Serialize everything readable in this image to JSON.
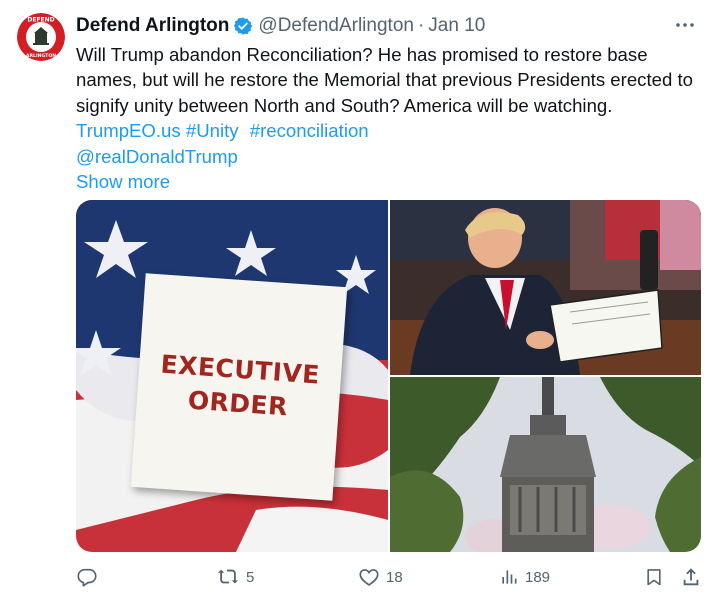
{
  "account": {
    "display_name": "Defend Arlington",
    "handle": "@DefendArlington",
    "separator": "·",
    "date": "Jan 10",
    "avatar_text_top": "DEFEND",
    "avatar_text_bottom": "ARLINGTON"
  },
  "tweet": {
    "text": "Will Trump abandon Reconciliation?  He has promised to restore base names, but will he restore the Memorial that previous Presidents erected to signify unity between North and South? America will be watching.",
    "link1": "TrumpEO.us",
    "hashtags": [
      "#Unity",
      "#reconciliation"
    ],
    "mention": "@realDonaldTrump",
    "show_more": "Show more"
  },
  "media": {
    "card_line1": "EXECUTIVE",
    "card_line2": "ORDER"
  },
  "actions": {
    "reply_count": "",
    "retweet_count": "5",
    "like_count": "18",
    "views_count": "189"
  },
  "colors": {
    "link": "#1d9bf0",
    "secondary": "#536471",
    "text": "#0f1419",
    "verified": "#1d9bf0"
  },
  "icons": [
    "verified-badge-icon",
    "more-icon",
    "reply-icon",
    "retweet-icon",
    "like-icon",
    "views-icon",
    "bookmark-icon",
    "share-icon"
  ]
}
